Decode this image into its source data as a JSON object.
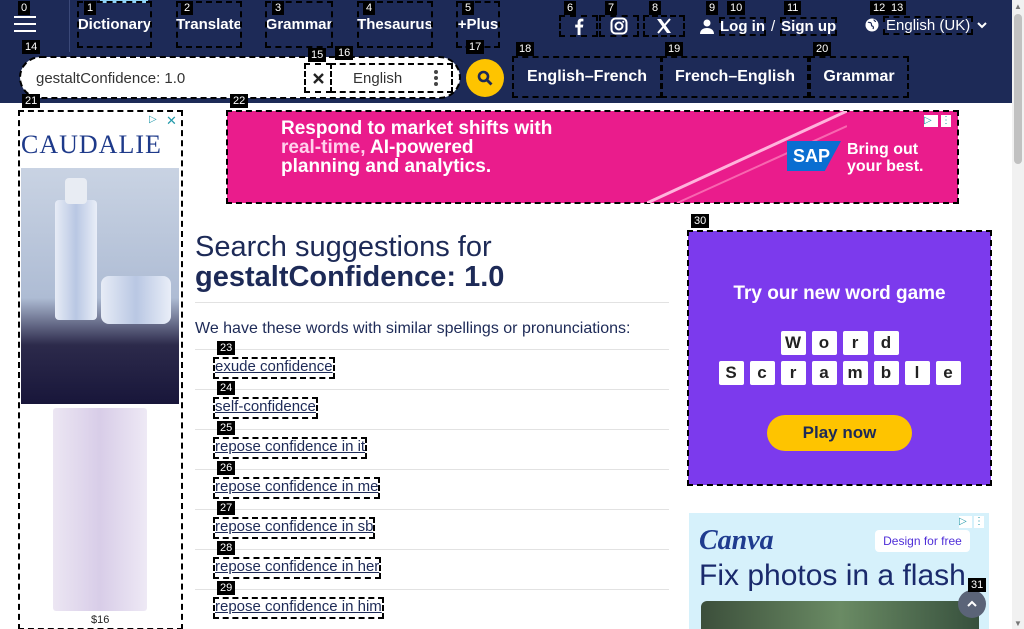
{
  "header": {
    "nav": [
      "Dictionary",
      "Translate",
      "Grammar",
      "Thesaurus",
      "+Plus"
    ],
    "login_label": "Log in",
    "login_sep": "/",
    "signup_label": "Sign up",
    "language": "English (UK)"
  },
  "search": {
    "value": "gestaltConfidence: 1.0",
    "dictionary": "English",
    "sub_nav": [
      "English–French",
      "French–English",
      "Grammar"
    ]
  },
  "tags": [
    "0",
    "1",
    "2",
    "3",
    "4",
    "5",
    "6",
    "7",
    "8",
    "9",
    "10",
    "11",
    "12",
    "13",
    "14",
    "15",
    "16",
    "17",
    "18",
    "19",
    "20",
    "21",
    "22",
    "23",
    "24",
    "25",
    "26",
    "27",
    "28",
    "29",
    "30",
    "31"
  ],
  "ads": {
    "left": {
      "brand": "CAUDALIE",
      "price": "$16"
    },
    "top": {
      "line1": "Respond to market shifts with",
      "line2_highlight": "real-time,",
      "line2_rest": " AI-powered",
      "line3": "planning and analytics.",
      "logo": "SAP",
      "tagline_1": "Bring out",
      "tagline_2": "your best."
    },
    "word_game": {
      "heading": "Try our new word game",
      "row1": [
        "W",
        "o",
        "r",
        "d"
      ],
      "row2": [
        "S",
        "c",
        "r",
        "a",
        "m",
        "b",
        "l",
        "e"
      ],
      "button": "Play now"
    },
    "canva": {
      "logo": "Canva",
      "button": "Design for free",
      "headline": "Fix photos in a flash"
    }
  },
  "results": {
    "title_prefix": "Search suggestions for",
    "query": "gestaltConfidence: 1.0",
    "intro": "We have these words with similar spellings or pronunciations:",
    "suggestions": [
      "exude confidence",
      "self-confidence",
      "repose confidence in it",
      "repose confidence in me",
      "repose confidence in sb",
      "repose confidence in her",
      "repose confidence in him"
    ]
  },
  "colors": {
    "navy": "#1d2a57",
    "yellow": "#fec400",
    "pink": "#ea1c8c",
    "purple": "#7c3aed"
  }
}
